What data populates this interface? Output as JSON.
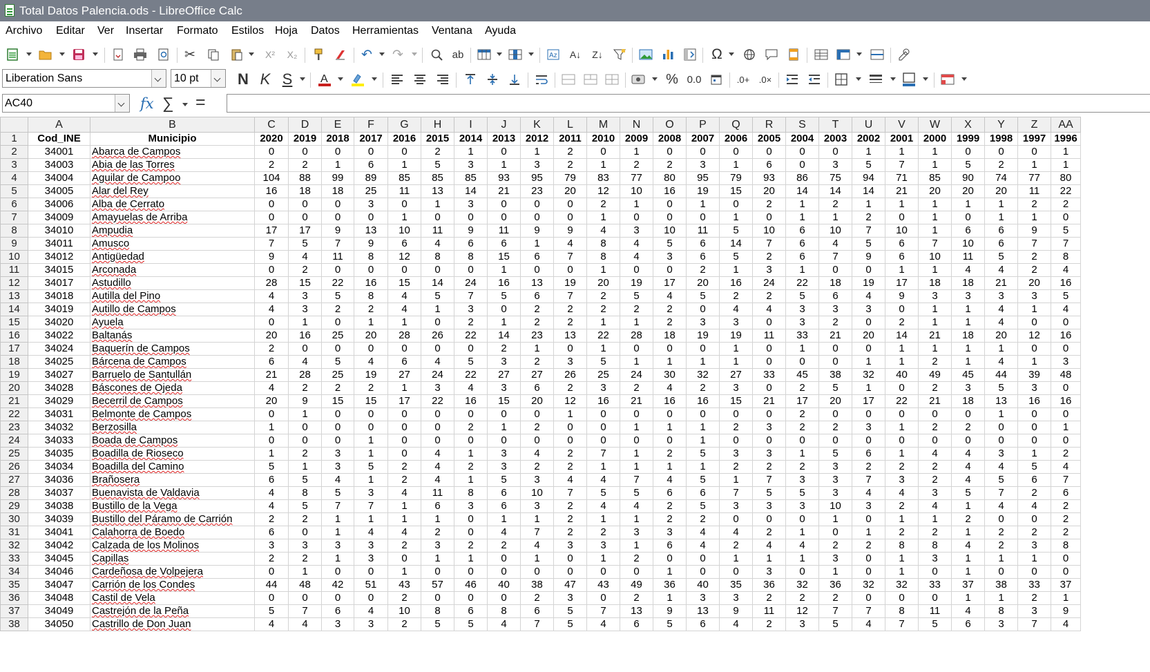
{
  "window": {
    "title": "Total Datos Palencia.ods - LibreOffice Calc"
  },
  "menu": [
    "Archivo",
    "Editar",
    "Ver",
    "Insertar",
    "Formato",
    "Estilos",
    "Hoja",
    "Datos",
    "Herramientas",
    "Ventana",
    "Ayuda"
  ],
  "toolbar2": {
    "font_name": "Liberation Sans",
    "font_size": "10 pt",
    "bold": "N",
    "italic": "K",
    "underline": "S",
    "percent": "%"
  },
  "formula_bar": {
    "cell_ref": "AC40",
    "fx": "fx",
    "sigma": "∑",
    "equals": "="
  },
  "grid": {
    "columns": [
      "A",
      "B",
      "C",
      "D",
      "E",
      "F",
      "G",
      "H",
      "I",
      "J",
      "K",
      "L",
      "M",
      "N",
      "O",
      "P",
      "Q",
      "R",
      "S",
      "T",
      "U",
      "V",
      "W",
      "X",
      "Y",
      "Z",
      "AA"
    ],
    "header": [
      "Cod_INE",
      "Municipio",
      "2020",
      "2019",
      "2018",
      "2017",
      "2016",
      "2015",
      "2014",
      "2013",
      "2012",
      "2011",
      "2010",
      "2009",
      "2008",
      "2007",
      "2006",
      "2005",
      "2004",
      "2003",
      "2002",
      "2001",
      "2000",
      "1999",
      "1998",
      "1997",
      "1996"
    ],
    "rows": [
      {
        "code": "34001",
        "name": "Abarca de Campos",
        "values": [
          "0",
          "0",
          "0",
          "0",
          "0",
          "2",
          "1",
          "0",
          "1",
          "2",
          "0",
          "1",
          "0",
          "0",
          "0",
          "0",
          "0",
          "0",
          "1",
          "1",
          "1",
          "0",
          "0",
          "0",
          "1"
        ]
      },
      {
        "code": "34003",
        "name": "Abia de las Torres",
        "values": [
          "2",
          "2",
          "1",
          "6",
          "1",
          "5",
          "3",
          "1",
          "3",
          "2",
          "1",
          "2",
          "2",
          "3",
          "1",
          "6",
          "0",
          "3",
          "5",
          "7",
          "1",
          "5",
          "2",
          "1",
          "1"
        ]
      },
      {
        "code": "34004",
        "name": "Aguilar de Campoo",
        "values": [
          "104",
          "88",
          "99",
          "89",
          "85",
          "85",
          "85",
          "93",
          "95",
          "79",
          "83",
          "77",
          "80",
          "95",
          "79",
          "93",
          "86",
          "75",
          "94",
          "71",
          "85",
          "90",
          "74",
          "77",
          "80"
        ]
      },
      {
        "code": "34005",
        "name": "Alar del Rey",
        "values": [
          "16",
          "18",
          "18",
          "25",
          "11",
          "13",
          "14",
          "21",
          "23",
          "20",
          "12",
          "10",
          "16",
          "19",
          "15",
          "20",
          "14",
          "14",
          "14",
          "21",
          "20",
          "20",
          "20",
          "11",
          "22"
        ]
      },
      {
        "code": "34006",
        "name": "Alba de Cerrato",
        "values": [
          "0",
          "0",
          "0",
          "3",
          "0",
          "1",
          "3",
          "0",
          "0",
          "0",
          "2",
          "1",
          "0",
          "1",
          "0",
          "2",
          "1",
          "2",
          "1",
          "1",
          "1",
          "1",
          "1",
          "2",
          "2"
        ]
      },
      {
        "code": "34009",
        "name": "Amayuelas de Arriba",
        "values": [
          "0",
          "0",
          "0",
          "0",
          "1",
          "0",
          "0",
          "0",
          "0",
          "0",
          "1",
          "0",
          "0",
          "0",
          "1",
          "0",
          "1",
          "1",
          "2",
          "0",
          "1",
          "0",
          "1",
          "1",
          "0"
        ]
      },
      {
        "code": "34010",
        "name": "Ampudia",
        "values": [
          "17",
          "17",
          "9",
          "13",
          "10",
          "11",
          "9",
          "11",
          "9",
          "9",
          "4",
          "3",
          "10",
          "11",
          "5",
          "10",
          "6",
          "10",
          "7",
          "10",
          "1",
          "6",
          "6",
          "9",
          "5"
        ]
      },
      {
        "code": "34011",
        "name": "Amusco",
        "values": [
          "7",
          "5",
          "7",
          "9",
          "6",
          "4",
          "6",
          "6",
          "1",
          "4",
          "8",
          "4",
          "5",
          "6",
          "14",
          "7",
          "6",
          "4",
          "5",
          "6",
          "7",
          "10",
          "6",
          "7",
          "7"
        ]
      },
      {
        "code": "34012",
        "name": "Antigüedad",
        "values": [
          "9",
          "4",
          "11",
          "8",
          "12",
          "8",
          "8",
          "15",
          "6",
          "7",
          "8",
          "4",
          "3",
          "6",
          "5",
          "2",
          "6",
          "7",
          "9",
          "6",
          "10",
          "11",
          "5",
          "2",
          "8"
        ]
      },
      {
        "code": "34015",
        "name": "Arconada",
        "values": [
          "0",
          "2",
          "0",
          "0",
          "0",
          "0",
          "0",
          "1",
          "0",
          "0",
          "1",
          "0",
          "0",
          "2",
          "1",
          "3",
          "1",
          "0",
          "0",
          "1",
          "1",
          "4",
          "4",
          "2",
          "4"
        ]
      },
      {
        "code": "34017",
        "name": "Astudillo",
        "values": [
          "28",
          "15",
          "22",
          "16",
          "15",
          "14",
          "24",
          "16",
          "13",
          "19",
          "20",
          "19",
          "17",
          "20",
          "16",
          "24",
          "22",
          "18",
          "19",
          "17",
          "18",
          "18",
          "21",
          "20",
          "16"
        ]
      },
      {
        "code": "34018",
        "name": "Autilla del Pino",
        "values": [
          "4",
          "3",
          "5",
          "8",
          "4",
          "5",
          "7",
          "5",
          "6",
          "7",
          "2",
          "5",
          "4",
          "5",
          "2",
          "2",
          "5",
          "6",
          "4",
          "9",
          "3",
          "3",
          "3",
          "3",
          "5"
        ]
      },
      {
        "code": "34019",
        "name": "Autillo de Campos",
        "values": [
          "4",
          "3",
          "2",
          "2",
          "4",
          "1",
          "3",
          "0",
          "2",
          "2",
          "2",
          "2",
          "2",
          "0",
          "4",
          "4",
          "3",
          "3",
          "3",
          "0",
          "1",
          "1",
          "4",
          "1",
          "4"
        ]
      },
      {
        "code": "34020",
        "name": "Ayuela",
        "values": [
          "0",
          "1",
          "0",
          "1",
          "1",
          "0",
          "2",
          "1",
          "2",
          "2",
          "1",
          "1",
          "2",
          "3",
          "3",
          "0",
          "3",
          "2",
          "0",
          "2",
          "1",
          "1",
          "4",
          "0",
          "0"
        ]
      },
      {
        "code": "34022",
        "name": "Baltanás",
        "values": [
          "20",
          "16",
          "25",
          "20",
          "28",
          "26",
          "22",
          "14",
          "23",
          "13",
          "22",
          "28",
          "18",
          "19",
          "19",
          "11",
          "33",
          "21",
          "20",
          "14",
          "21",
          "18",
          "20",
          "12",
          "16"
        ]
      },
      {
        "code": "34024",
        "name": "Baquerín de Campos",
        "values": [
          "2",
          "0",
          "0",
          "0",
          "0",
          "0",
          "0",
          "2",
          "1",
          "0",
          "1",
          "0",
          "0",
          "0",
          "1",
          "0",
          "1",
          "0",
          "0",
          "1",
          "1",
          "1",
          "1",
          "0",
          "0"
        ]
      },
      {
        "code": "34025",
        "name": "Bárcena de Campos",
        "values": [
          "6",
          "4",
          "5",
          "4",
          "6",
          "4",
          "5",
          "3",
          "2",
          "3",
          "5",
          "1",
          "1",
          "1",
          "1",
          "0",
          "0",
          "0",
          "1",
          "1",
          "2",
          "1",
          "4",
          "1",
          "3"
        ]
      },
      {
        "code": "34027",
        "name": "Barruelo de Santullán",
        "values": [
          "21",
          "28",
          "25",
          "19",
          "27",
          "24",
          "22",
          "27",
          "27",
          "26",
          "25",
          "24",
          "30",
          "32",
          "27",
          "33",
          "45",
          "38",
          "32",
          "40",
          "49",
          "45",
          "44",
          "39",
          "48"
        ]
      },
      {
        "code": "34028",
        "name": "Báscones de Ojeda",
        "values": [
          "4",
          "2",
          "2",
          "2",
          "1",
          "3",
          "4",
          "3",
          "6",
          "2",
          "3",
          "2",
          "4",
          "2",
          "3",
          "0",
          "2",
          "5",
          "1",
          "0",
          "2",
          "3",
          "5",
          "3",
          "0"
        ]
      },
      {
        "code": "34029",
        "name": "Becerril de Campos",
        "values": [
          "20",
          "9",
          "15",
          "15",
          "17",
          "22",
          "16",
          "15",
          "20",
          "12",
          "16",
          "21",
          "16",
          "16",
          "15",
          "21",
          "17",
          "20",
          "17",
          "22",
          "21",
          "18",
          "13",
          "16",
          "16"
        ]
      },
      {
        "code": "34031",
        "name": "Belmonte de Campos",
        "values": [
          "0",
          "1",
          "0",
          "0",
          "0",
          "0",
          "0",
          "0",
          "0",
          "1",
          "0",
          "0",
          "0",
          "0",
          "0",
          "0",
          "2",
          "0",
          "0",
          "0",
          "0",
          "0",
          "1",
          "0",
          "0"
        ]
      },
      {
        "code": "34032",
        "name": "Berzosilla",
        "values": [
          "1",
          "0",
          "0",
          "0",
          "0",
          "0",
          "2",
          "1",
          "2",
          "0",
          "0",
          "1",
          "1",
          "1",
          "2",
          "3",
          "2",
          "2",
          "3",
          "1",
          "2",
          "2",
          "0",
          "0",
          "1"
        ]
      },
      {
        "code": "34033",
        "name": "Boada de Campos",
        "values": [
          "0",
          "0",
          "0",
          "1",
          "0",
          "0",
          "0",
          "0",
          "0",
          "0",
          "0",
          "0",
          "0",
          "1",
          "0",
          "0",
          "0",
          "0",
          "0",
          "0",
          "0",
          "0",
          "0",
          "0",
          "0"
        ]
      },
      {
        "code": "34035",
        "name": "Boadilla de Rioseco",
        "values": [
          "1",
          "2",
          "3",
          "1",
          "0",
          "4",
          "1",
          "3",
          "4",
          "2",
          "7",
          "1",
          "2",
          "5",
          "3",
          "3",
          "1",
          "5",
          "6",
          "1",
          "4",
          "4",
          "3",
          "1",
          "2"
        ]
      },
      {
        "code": "34034",
        "name": "Boadilla del Camino",
        "values": [
          "5",
          "1",
          "3",
          "5",
          "2",
          "4",
          "2",
          "3",
          "2",
          "2",
          "1",
          "1",
          "1",
          "1",
          "2",
          "2",
          "2",
          "3",
          "2",
          "2",
          "2",
          "4",
          "4",
          "5",
          "4"
        ]
      },
      {
        "code": "34036",
        "name": "Brañosera",
        "values": [
          "6",
          "5",
          "4",
          "1",
          "2",
          "4",
          "1",
          "5",
          "3",
          "4",
          "4",
          "7",
          "4",
          "5",
          "1",
          "7",
          "3",
          "3",
          "7",
          "3",
          "2",
          "4",
          "5",
          "6",
          "7"
        ]
      },
      {
        "code": "34037",
        "name": "Buenavista de Valdavia",
        "values": [
          "4",
          "8",
          "5",
          "3",
          "4",
          "11",
          "8",
          "6",
          "10",
          "7",
          "5",
          "5",
          "6",
          "6",
          "7",
          "5",
          "5",
          "3",
          "4",
          "4",
          "3",
          "5",
          "7",
          "2",
          "6"
        ]
      },
      {
        "code": "34038",
        "name": "Bustillo de la Vega",
        "values": [
          "4",
          "5",
          "7",
          "7",
          "1",
          "6",
          "3",
          "6",
          "3",
          "2",
          "4",
          "4",
          "2",
          "5",
          "3",
          "3",
          "3",
          "10",
          "3",
          "2",
          "4",
          "1",
          "4",
          "4",
          "2"
        ]
      },
      {
        "code": "34039",
        "name": "Bustillo del Páramo de Carrión",
        "values": [
          "2",
          "2",
          "1",
          "1",
          "1",
          "1",
          "0",
          "1",
          "1",
          "2",
          "1",
          "1",
          "2",
          "2",
          "0",
          "0",
          "0",
          "1",
          "0",
          "1",
          "1",
          "2",
          "0",
          "0",
          "2"
        ]
      },
      {
        "code": "34041",
        "name": "Calahorra de Boedo",
        "values": [
          "6",
          "0",
          "1",
          "4",
          "4",
          "2",
          "0",
          "4",
          "7",
          "2",
          "2",
          "3",
          "3",
          "4",
          "4",
          "2",
          "1",
          "0",
          "1",
          "2",
          "2",
          "1",
          "2",
          "2",
          "2"
        ]
      },
      {
        "code": "34042",
        "name": "Calzada de los Molinos",
        "values": [
          "3",
          "3",
          "3",
          "3",
          "2",
          "3",
          "2",
          "2",
          "4",
          "3",
          "3",
          "1",
          "6",
          "4",
          "2",
          "4",
          "4",
          "2",
          "2",
          "8",
          "8",
          "4",
          "2",
          "3",
          "8"
        ]
      },
      {
        "code": "34045",
        "name": "Capillas",
        "values": [
          "2",
          "2",
          "1",
          "3",
          "0",
          "1",
          "1",
          "0",
          "1",
          "0",
          "1",
          "2",
          "0",
          "0",
          "1",
          "1",
          "1",
          "3",
          "0",
          "1",
          "3",
          "1",
          "1",
          "1",
          "0"
        ]
      },
      {
        "code": "34046",
        "name": "Cardeñosa de Volpejera",
        "values": [
          "0",
          "1",
          "0",
          "0",
          "1",
          "0",
          "0",
          "0",
          "0",
          "0",
          "0",
          "0",
          "1",
          "0",
          "0",
          "3",
          "0",
          "1",
          "0",
          "1",
          "0",
          "1",
          "0",
          "0",
          "0"
        ]
      },
      {
        "code": "34047",
        "name": "Carrión de los Condes",
        "values": [
          "44",
          "48",
          "42",
          "51",
          "43",
          "57",
          "46",
          "40",
          "38",
          "47",
          "43",
          "49",
          "36",
          "40",
          "35",
          "36",
          "32",
          "36",
          "32",
          "32",
          "33",
          "37",
          "38",
          "33",
          "37"
        ]
      },
      {
        "code": "34048",
        "name": "Castil de Vela",
        "values": [
          "0",
          "0",
          "0",
          "0",
          "2",
          "0",
          "0",
          "0",
          "2",
          "3",
          "0",
          "2",
          "1",
          "3",
          "3",
          "2",
          "2",
          "2",
          "0",
          "0",
          "0",
          "1",
          "1",
          "2",
          "1"
        ]
      },
      {
        "code": "34049",
        "name": "Castrejón de la Peña",
        "values": [
          "5",
          "7",
          "6",
          "4",
          "10",
          "8",
          "6",
          "8",
          "6",
          "5",
          "7",
          "13",
          "9",
          "13",
          "9",
          "11",
          "12",
          "7",
          "7",
          "8",
          "11",
          "4",
          "8",
          "3",
          "9"
        ]
      },
      {
        "code": "34050",
        "name": "Castrillo de Don Juan",
        "values": [
          "4",
          "4",
          "3",
          "3",
          "2",
          "5",
          "5",
          "4",
          "7",
          "5",
          "4",
          "6",
          "5",
          "6",
          "4",
          "2",
          "3",
          "5",
          "4",
          "7",
          "5",
          "6",
          "3",
          "7",
          "4"
        ]
      }
    ]
  }
}
